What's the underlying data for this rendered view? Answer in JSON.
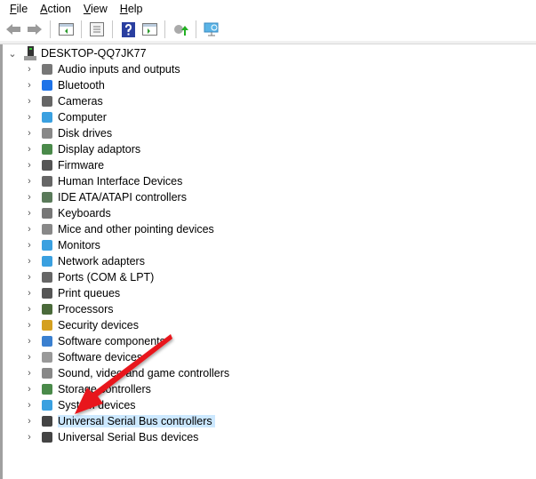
{
  "menu": {
    "items": [
      {
        "label": "File",
        "ul": "F",
        "rest": "ile"
      },
      {
        "label": "Action",
        "ul": "A",
        "rest": "ction"
      },
      {
        "label": "View",
        "ul": "V",
        "rest": "iew"
      },
      {
        "label": "Help",
        "ul": "H",
        "rest": "elp"
      }
    ]
  },
  "toolbar": [
    "back-icon",
    "forward-icon",
    "show-hide-console-tree-icon",
    "properties-icon",
    "help-icon",
    "action-pane-icon",
    "update-driver-icon",
    "scan-hardware-icon"
  ],
  "tree": {
    "root": "DESKTOP-QQ7JK77",
    "items": [
      {
        "label": "Audio inputs and outputs",
        "icon": "speaker-icon",
        "color": "#777"
      },
      {
        "label": "Bluetooth",
        "icon": "bluetooth-icon",
        "color": "#1e73e8"
      },
      {
        "label": "Cameras",
        "icon": "camera-icon",
        "color": "#666"
      },
      {
        "label": "Computer",
        "icon": "computer-icon",
        "color": "#3aa0e0"
      },
      {
        "label": "Disk drives",
        "icon": "disk-drive-icon",
        "color": "#888"
      },
      {
        "label": "Display adaptors",
        "icon": "display-adapter-icon",
        "color": "#4a8a4a"
      },
      {
        "label": "Firmware",
        "icon": "firmware-icon",
        "color": "#555"
      },
      {
        "label": "Human Interface Devices",
        "icon": "hid-icon",
        "color": "#666"
      },
      {
        "label": "IDE ATA/ATAPI controllers",
        "icon": "ide-controller-icon",
        "color": "#5a7a5a"
      },
      {
        "label": "Keyboards",
        "icon": "keyboard-icon",
        "color": "#777"
      },
      {
        "label": "Mice and other pointing devices",
        "icon": "mouse-icon",
        "color": "#888"
      },
      {
        "label": "Monitors",
        "icon": "monitor-icon",
        "color": "#3aa0e0"
      },
      {
        "label": "Network adapters",
        "icon": "network-adapter-icon",
        "color": "#3aa0e0"
      },
      {
        "label": "Ports (COM & LPT)",
        "icon": "port-icon",
        "color": "#666"
      },
      {
        "label": "Print queues",
        "icon": "printer-icon",
        "color": "#555"
      },
      {
        "label": "Processors",
        "icon": "processor-icon",
        "color": "#4a6a3a"
      },
      {
        "label": "Security devices",
        "icon": "security-device-icon",
        "color": "#d4a020"
      },
      {
        "label": "Software components",
        "icon": "software-component-icon",
        "color": "#3a80d0"
      },
      {
        "label": "Software devices",
        "icon": "software-device-icon",
        "color": "#999"
      },
      {
        "label": "Sound, video and game controllers",
        "icon": "sound-icon",
        "color": "#888"
      },
      {
        "label": "Storage controllers",
        "icon": "storage-controller-icon",
        "color": "#4a8a4a"
      },
      {
        "label": "System devices",
        "icon": "system-device-icon",
        "color": "#3aa0e0"
      },
      {
        "label": "Universal Serial Bus controllers",
        "icon": "usb-icon",
        "color": "#444",
        "selected": true
      },
      {
        "label": "Universal Serial Bus devices",
        "icon": "usb-icon",
        "color": "#444"
      }
    ]
  },
  "annotation": {
    "arrow_color": "#e8141a"
  }
}
